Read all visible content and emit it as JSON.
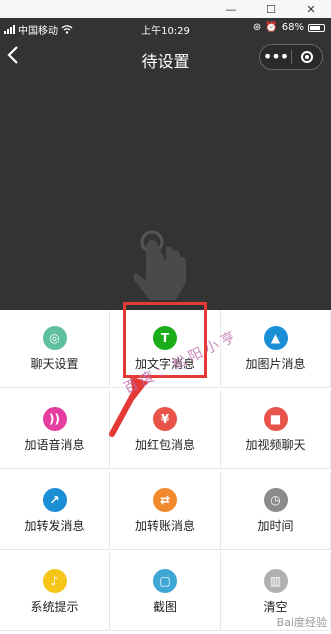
{
  "window": {
    "minimize": "—",
    "maximize": "☐",
    "close": "✕"
  },
  "status": {
    "carrier": "中国移动",
    "time": "上午10:29",
    "battery": "68%"
  },
  "nav": {
    "back": "<",
    "title": "待设置",
    "more": "•••"
  },
  "grid": [
    {
      "label": "聊天设置",
      "color": "#5fc0a0",
      "glyph": "◎"
    },
    {
      "label": "加文字消息",
      "color": "#1aad19",
      "glyph": "T"
    },
    {
      "label": "加图片消息",
      "color": "#1a8fd6",
      "glyph": "▲"
    },
    {
      "label": "加语音消息",
      "color": "#e53ea0",
      "glyph": "))"
    },
    {
      "label": "加红包消息",
      "color": "#e8534a",
      "glyph": "¥"
    },
    {
      "label": "加视频聊天",
      "color": "#e8534a",
      "glyph": "■"
    },
    {
      "label": "加转发消息",
      "color": "#1a8fd6",
      "glyph": "↗"
    },
    {
      "label": "加转账消息",
      "color": "#f08a2c",
      "glyph": "⇄"
    },
    {
      "label": "加时间",
      "color": "#8a8a8a",
      "glyph": "◷"
    },
    {
      "label": "系统提示",
      "color": "#f5c518",
      "glyph": "♪"
    },
    {
      "label": "截图",
      "color": "#3fa7d6",
      "glyph": "▢"
    },
    {
      "label": "清空",
      "color": "#b0b0b0",
      "glyph": "▥"
    }
  ],
  "overlay": {
    "watermark": "百度：松阳小亨",
    "baidu": "Bai度经验"
  },
  "colors": {
    "highlight": "#e53935",
    "arrow": "#e53935"
  }
}
